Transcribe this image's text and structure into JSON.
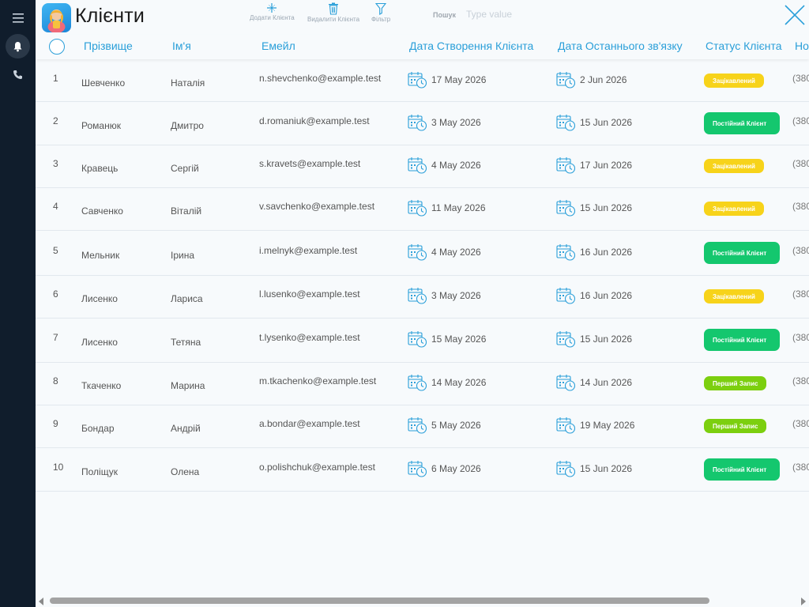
{
  "sidebar": {
    "items": [
      {
        "icon": "menu-icon"
      },
      {
        "icon": "bell-icon",
        "active": true
      },
      {
        "icon": "phone-icon"
      }
    ]
  },
  "header": {
    "title": "Клієнти",
    "tools": {
      "add_label": "Додати Клієнта",
      "delete_label": "Видалити Клієнта",
      "filter_label": "Фільтр"
    },
    "search": {
      "label": "Пошук",
      "placeholder": "Type value",
      "value": ""
    }
  },
  "table": {
    "columns": {
      "last_name": "Прізвище",
      "first_name": "Ім'я",
      "email": "Емейл",
      "created": "Дата Створення Клієнта",
      "last_contact": "Дата Останнього зв'язку",
      "status": "Статус Клієнта",
      "phone": "Но"
    },
    "rows": [
      {
        "num": "1",
        "last_name": "Шевченко",
        "first_name": "Наталія",
        "email": "n.shevchenko@example.test",
        "created": "17 May 2026",
        "last_contact": "2 Jun 2026",
        "status": "Зацікавлений",
        "status_kind": "yellow",
        "phone": "(380"
      },
      {
        "num": "2",
        "last_name": "Романюк",
        "first_name": "Дмитро",
        "email": "d.romaniuk@example.test",
        "created": "3 May 2026",
        "last_contact": "15 Jun 2026",
        "status": "Постійний Клієнт",
        "status_kind": "green",
        "phone": "(380"
      },
      {
        "num": "3",
        "last_name": "Кравець",
        "first_name": "Сергій",
        "email": "s.kravets@example.test",
        "created": "4 May 2026",
        "last_contact": "17 Jun 2026",
        "status": "Зацікавлений",
        "status_kind": "yellow",
        "phone": "(380"
      },
      {
        "num": "4",
        "last_name": "Савченко",
        "first_name": "Віталій",
        "email": "v.savchenko@example.test",
        "created": "11 May 2026",
        "last_contact": "15 Jun 2026",
        "status": "Зацікавлений",
        "status_kind": "yellow",
        "phone": "(380"
      },
      {
        "num": "5",
        "last_name": "Мельник",
        "first_name": "Ірина",
        "email": "i.melnyk@example.test",
        "created": "4 May 2026",
        "last_contact": "16 Jun 2026",
        "status": "Постійний Клієнт",
        "status_kind": "green",
        "phone": "(380"
      },
      {
        "num": "6",
        "last_name": "Лисенко",
        "first_name": "Лариса",
        "email": "l.lusenko@example.test",
        "created": "3 May 2026",
        "last_contact": "16 Jun 2026",
        "status": "Зацікавлений",
        "status_kind": "yellow",
        "phone": "(380"
      },
      {
        "num": "7",
        "last_name": "Лисенко",
        "first_name": "Тетяна",
        "email": "t.lysenko@example.test",
        "created": "15 May 2026",
        "last_contact": "15 Jun 2026",
        "status": "Постійний Клієнт",
        "status_kind": "green",
        "phone": "(380"
      },
      {
        "num": "8",
        "last_name": "Ткаченко",
        "first_name": "Марина",
        "email": "m.tkachenko@example.test",
        "created": "14 May 2026",
        "last_contact": "14 Jun 2026",
        "status": "Перший Запис",
        "status_kind": "lime",
        "phone": "(380"
      },
      {
        "num": "9",
        "last_name": "Бондар",
        "first_name": "Андрій",
        "email": "a.bondar@example.test",
        "created": "5 May 2026",
        "last_contact": "19 May 2026",
        "status": "Перший Запис",
        "status_kind": "lime",
        "phone": "(380"
      },
      {
        "num": "10",
        "last_name": "Поліщук",
        "first_name": "Олена",
        "email": "o.polishchuk@example.test",
        "created": "6 May 2026",
        "last_contact": "15 Jun 2026",
        "status": "Постійний Клієнт",
        "status_kind": "green",
        "phone": "(380"
      }
    ]
  },
  "colors": {
    "sidebar_bg": "#101d2c",
    "accent": "#2a9fd9",
    "status_yellow": "#f7d31a",
    "status_green": "#14c76e",
    "status_lime": "#7ccf0f"
  }
}
